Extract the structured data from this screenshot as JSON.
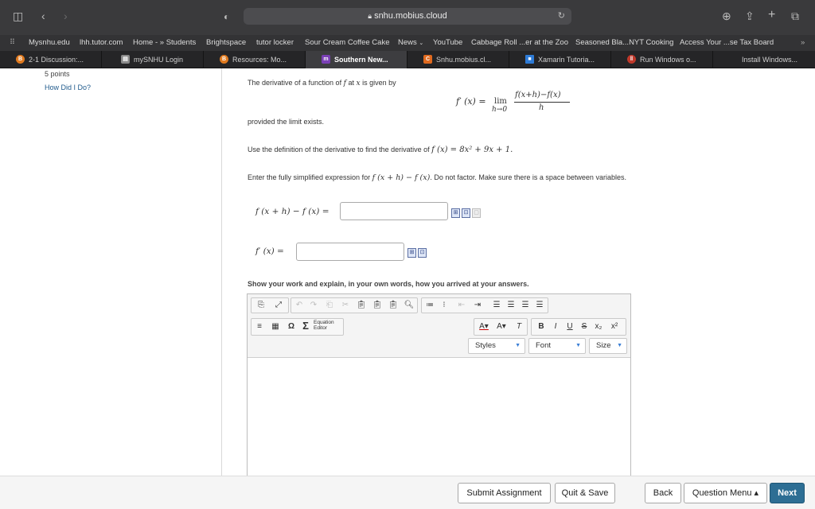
{
  "browser": {
    "url": "snhu.mobius.cloud",
    "bookmarks": [
      "Mysnhu.edu",
      "lhh.tutor.com",
      "Home - » Students",
      "Brightspace",
      "tutor locker",
      "Sour Cream Coffee Cake",
      "News",
      "YouTube",
      "Cabbage Roll ...er at the Zoo",
      "Seasoned Bla...NYT Cooking",
      "Access Your ...se Tax Board"
    ],
    "tabs": [
      {
        "label": "2-1 Discussion:...",
        "icon_color": "#e07a1f",
        "icon_char": "B"
      },
      {
        "label": "mySNHU Login",
        "icon_color": "#8a8a8a",
        "icon_char": "▤"
      },
      {
        "label": "Resources: Mo...",
        "icon_color": "#e07a1f",
        "icon_char": "B"
      },
      {
        "label": "Southern New...",
        "icon_color": "#7a3fb5",
        "icon_char": "m"
      },
      {
        "label": "Snhu.mobius.cl...",
        "icon_color": "#e06a1f",
        "icon_char": "C"
      },
      {
        "label": "Xamarin Tutoria...",
        "icon_color": "#2e7bd6",
        "icon_char": "■"
      },
      {
        "label": "Run Windows o...",
        "icon_color": "#c0392b",
        "icon_char": "‖"
      },
      {
        "label": "Install Windows...",
        "icon_color": "#999",
        "icon_char": ""
      }
    ],
    "active_tab": 3
  },
  "sidebar": {
    "points": "5 points",
    "how_did_i_do": "How Did I Do?"
  },
  "question": {
    "intro": "The derivative of a function of",
    "intro_f": "f",
    "intro_at": "at",
    "intro_x": "x",
    "intro_end": "is given by",
    "formula_lhs": "f′ (x) =",
    "formula_lim": "lim",
    "formula_sub": "h→0",
    "formula_num": "f(x+h)−f(x)",
    "formula_den": "h",
    "provided": "provided the limit exists.",
    "use_def": "Use the definition of the derivative to find the derivative of",
    "use_def_math": "f (x) = 8x² + 9x + 1.",
    "enter_text_a": "Enter the fully simplified expression for",
    "enter_math": "f (x + h) − f (x)",
    "enter_text_b": ". Do not factor. Make sure there is a space between variables.",
    "label1": "f (x + h) − f (x) =",
    "label2": "f′ (x) =",
    "show_work": "Show your work and explain, in your own words, how you arrived at your answers."
  },
  "editor": {
    "eq_editor_label": "Equation Editor",
    "styles": "Styles",
    "font": "Font",
    "size": "Size"
  },
  "footer": {
    "submit": "Submit Assignment",
    "quit": "Quit & Save",
    "back": "Back",
    "menu": "Question Menu ▴",
    "next": "Next"
  }
}
